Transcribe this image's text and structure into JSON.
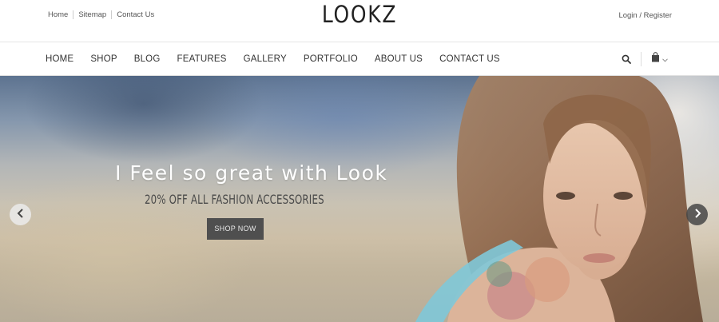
{
  "topbar": {
    "links": [
      "Home",
      "Sitemap",
      "Contact Us"
    ],
    "logo": "LOOKZ",
    "login": "Login / Register"
  },
  "nav": {
    "items": [
      "HOME",
      "SHOP",
      "BLOG",
      "FEATURES",
      "GALLERY",
      "PORTFOLIO",
      "ABOUT US",
      "CONTACT US"
    ],
    "icons": [
      "search-icon",
      "shopping-bag-icon",
      "chevron-down-icon"
    ]
  },
  "hero": {
    "headline": "I Feel so great with Look",
    "subline": "20% OFF ALL FASHION ACCESSORIES",
    "button": "SHOP NOW",
    "arrows": [
      "chevron-left-icon",
      "chevron-right-icon"
    ]
  },
  "colors": {
    "button_bg": "#4f4f4f",
    "headline": "#ffffff",
    "text_dark": "#333333"
  }
}
